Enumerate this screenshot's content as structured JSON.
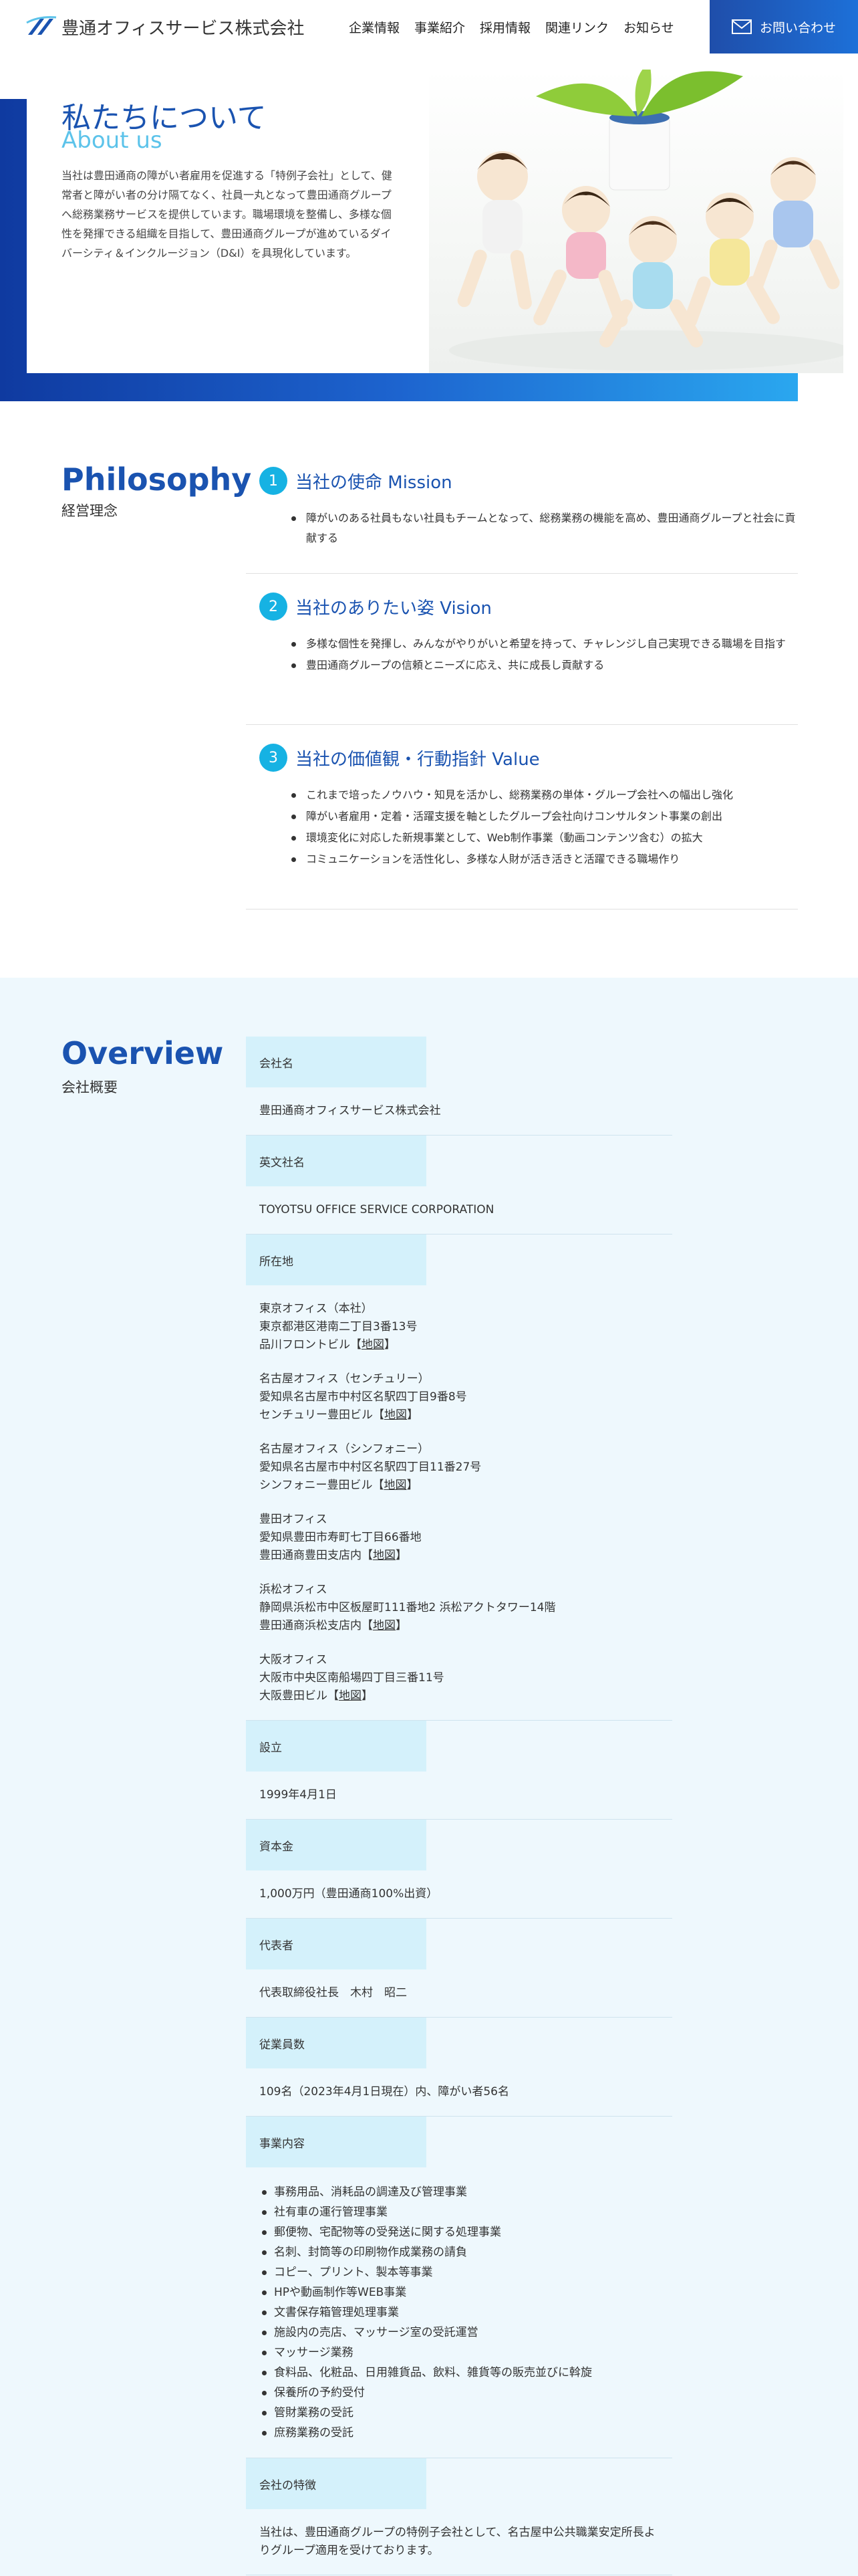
{
  "header": {
    "logo_text": "豊通オフィスサービス株式会社",
    "nav": [
      "企業情報",
      "事業紹介",
      "採用情報",
      "関連リンク",
      "お知らせ"
    ],
    "contact_label": "お問い合わせ"
  },
  "hero": {
    "title": "私たちについて",
    "subtitle": "About us",
    "text": "当社は豊田通商の障がい者雇用を促進する「特例子会社」として、健常者と障がい者の分け隔てなく、社員一丸となって豊田通商グループへ総務業務サービスを提供しています。職場環境を整備し、多様な個性を発揮できる組織を目指して、豊田通商グループが進めているダイバーシティ＆インクルージョン（D&I）を具現化しています。"
  },
  "philosophy": {
    "title": "Philosophy",
    "subtitle": "経営理念",
    "blocks": [
      {
        "num": "1",
        "heading": "当社の使命 Mission",
        "items": [
          "障がいのある社員もない社員もチームとなって、総務業務の機能を高め、豊田通商グループと社会に貢献する"
        ]
      },
      {
        "num": "2",
        "heading": "当社のありたい姿 Vision",
        "items": [
          "多様な個性を発揮し、みんながやりがいと希望を持って、チャレンジし自己実現できる職場を目指す",
          "豊田通商グループの信頼とニーズに応え、共に成長し貢献する"
        ]
      },
      {
        "num": "3",
        "heading": "当社の価値観・行動指針 Value",
        "items": [
          "これまで培ったノウハウ・知見を活かし、総務業務の単体・グループ会社への幅出し強化",
          "障がい者雇用・定着・活躍支援を軸としたグループ会社向けコンサルタント事業の創出",
          "環境変化に対応した新規事業として、Web制作事業（動画コンテンツ含む）の拡大",
          "コミュニケーションを活性化し、多様な人財が活き活きと活躍できる職場作り"
        ]
      }
    ]
  },
  "overview": {
    "title": "Overview",
    "subtitle": "会社概要",
    "company_name_label": "会社名",
    "company_name": "豊田通商オフィスサービス株式会社",
    "english_name_label": "英文社名",
    "english_name": "TOYOTSU OFFICE SERVICE CORPORATION",
    "address_label": "所在地",
    "map_link": "地図",
    "offices": [
      {
        "name": "東京オフィス（本社）",
        "addr": "東京都港区港南二丁目3番13号",
        "bldg": "品川フロントビル"
      },
      {
        "name": "名古屋オフィス（センチュリー）",
        "addr": "愛知県名古屋市中村区名駅四丁目9番8号",
        "bldg": "センチュリー豊田ビル"
      },
      {
        "name": "名古屋オフィス（シンフォニー）",
        "addr": "愛知県名古屋市中村区名駅四丁目11番27号",
        "bldg": "シンフォニー豊田ビル"
      },
      {
        "name": "豊田オフィス",
        "addr": "愛知県豊田市寿町七丁目66番地",
        "bldg": "豊田通商豊田支店内"
      },
      {
        "name": "浜松オフィス",
        "addr": "静岡県浜松市中区板屋町111番地2 浜松アクトタワー14階",
        "bldg": "豊田通商浜松支店内"
      },
      {
        "name": "大阪オフィス",
        "addr": "大阪市中央区南船場四丁目三番11号",
        "bldg": "大阪豊田ビル"
      }
    ],
    "founded_label": "設立",
    "founded": "1999年4月1日",
    "capital_label": "資本金",
    "capital": "1,000万円（豊田通商100%出資）",
    "rep_label": "代表者",
    "rep": "代表取締役社長　木村　昭二",
    "employees_label": "従業員数",
    "employees": "109名（2023年4月1日現在）内、障がい者56名",
    "business_label": "事業内容",
    "business": [
      "事務用品、消耗品の調達及び管理事業",
      "社有車の運行管理事業",
      "郵便物、宅配物等の受発送に関する処理事業",
      "名刺、封筒等の印刷物作成業務の請負",
      "コピー、プリント、製本等事業",
      "HPや動画制作等WEB事業",
      "文書保存箱管理処理事業",
      "施設内の売店、マッサージ室の受託運営",
      "マッサージ業務",
      "食料品、化粧品、日用雑貨品、飲料、雑貨等の販売並びに斡旋",
      "保養所の予約受付",
      "管財業務の受託",
      "庶務業務の受託"
    ],
    "feature_label": "会社の特徴",
    "feature": "当社は、豊田通商グループの特例子会社として、名古屋中公共職業安定所長よりグループ適用を受けております。"
  }
}
